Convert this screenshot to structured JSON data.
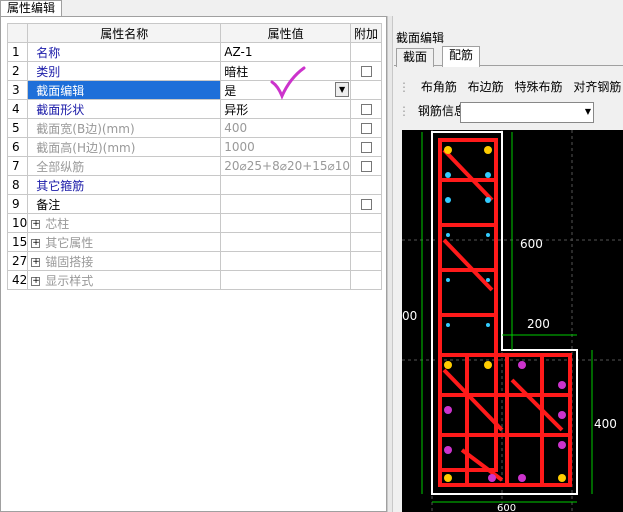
{
  "left_tab": {
    "label": "属性编辑"
  },
  "grid": {
    "headers": {
      "name": "属性名称",
      "value": "属性值",
      "add": "附加"
    },
    "rows": [
      {
        "num": "1",
        "name": "名称",
        "value": "AZ-1",
        "checkbox": false,
        "style": "blue"
      },
      {
        "num": "2",
        "name": "类别",
        "value": "暗柱",
        "checkbox": true,
        "style": "blue"
      },
      {
        "num": "3",
        "name": "截面编辑",
        "value": "是",
        "checkbox": false,
        "style": "selected"
      },
      {
        "num": "4",
        "name": "截面形状",
        "value": "异形",
        "checkbox": true,
        "style": "blue"
      },
      {
        "num": "5",
        "name": "截面宽(B边)(mm)",
        "value": "400",
        "checkbox": true,
        "style": "gray"
      },
      {
        "num": "6",
        "name": "截面高(H边)(mm)",
        "value": "1000",
        "checkbox": true,
        "style": "gray"
      },
      {
        "num": "7",
        "name": "全部纵筋",
        "value": "20⌀25+8⌀20+15⌀10",
        "checkbox": true,
        "style": "gray"
      },
      {
        "num": "8",
        "name": "其它箍筋",
        "value": "",
        "checkbox": false,
        "style": "blue"
      },
      {
        "num": "9",
        "name": "备注",
        "value": "",
        "checkbox": true,
        "style": "black"
      },
      {
        "num": "10",
        "name": "芯柱",
        "value": "",
        "checkbox": false,
        "style": "group"
      },
      {
        "num": "15",
        "name": "其它属性",
        "value": "",
        "checkbox": false,
        "style": "group"
      },
      {
        "num": "27",
        "name": "锚固搭接",
        "value": "",
        "checkbox": false,
        "style": "group"
      },
      {
        "num": "42",
        "name": "显示样式",
        "value": "",
        "checkbox": false,
        "style": "group"
      }
    ]
  },
  "section_panel": {
    "title": "截面编辑",
    "tabs": [
      "截面",
      "配筋"
    ],
    "active_tab": "配筋",
    "toolbar": [
      "布角筋",
      "布边筋",
      "特殊布筋",
      "对齐钢筋"
    ],
    "rebar_info_label": "钢筋信息",
    "dims": {
      "top_width": "600",
      "notch_width": "200",
      "left_height": "00",
      "right_height": "400",
      "bottom": "600"
    }
  },
  "colors": {
    "selected_row": "#1e6fd9",
    "header_value": "#f6d88a",
    "rebar": "#ff1a1a",
    "outline": "#ffffff",
    "dim_line": "#00cc00",
    "canvas_bg": "#000000",
    "check_mark": "#cc33cc"
  }
}
